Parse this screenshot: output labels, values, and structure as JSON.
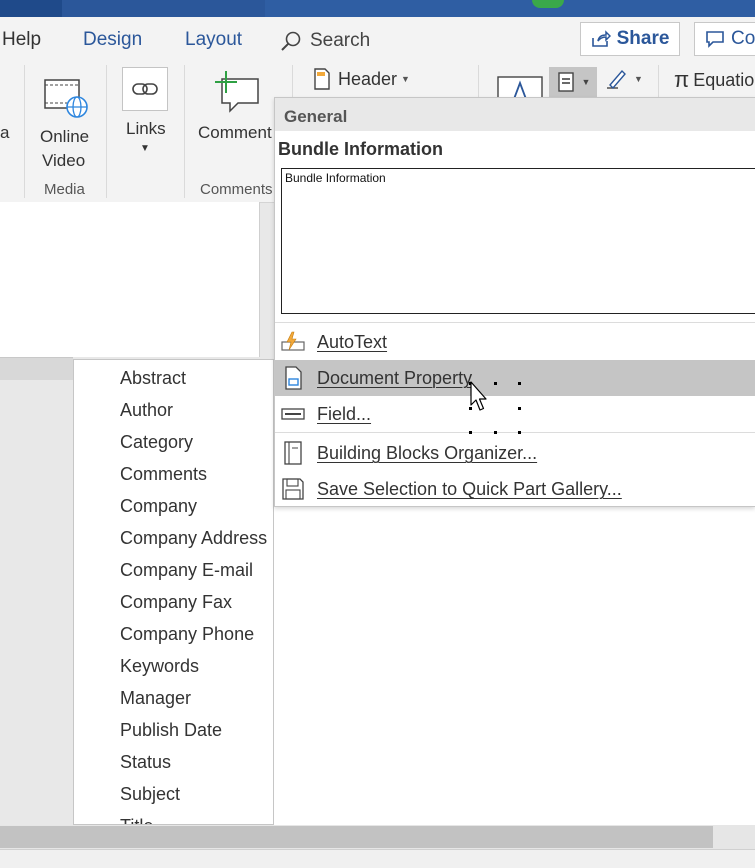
{
  "tabs": {
    "help": "Help",
    "design": "Design",
    "layout": "Layout",
    "search_placeholder": "Search"
  },
  "header_buttons": {
    "share": "Share",
    "comments": "Co"
  },
  "ribbon": {
    "partial_left": "a",
    "online_video_line1": "Online",
    "online_video_line2": "Video",
    "links": "Links",
    "comment": "Comment",
    "header": "Header",
    "equation": "Equatio",
    "groups": {
      "media": "Media",
      "comments": "Comments"
    }
  },
  "quick_parts_menu": {
    "general_header": "General",
    "bundle_title": "Bundle Information",
    "bundle_preview_text": "Bundle Information",
    "items": [
      {
        "label": "AutoText",
        "icon": "autotext-icon"
      },
      {
        "label": "Document Property",
        "icon": "document-property-icon",
        "highlighted": true
      },
      {
        "label": "Field...",
        "icon": "field-icon"
      },
      {
        "label": "Building Blocks Organizer...",
        "icon": "building-blocks-icon"
      },
      {
        "label": "Save Selection to Quick Part Gallery...",
        "icon": "save-selection-icon"
      }
    ]
  },
  "document_properties": [
    "Abstract",
    "Author",
    "Category",
    "Comments",
    "Company",
    "Company Address",
    "Company E-mail",
    "Company Fax",
    "Company Phone",
    "Keywords",
    "Manager",
    "Publish Date",
    "Status",
    "Subject",
    "Title"
  ],
  "colors": {
    "accent": "#2b579a",
    "menu_highlight": "#c5c5c5",
    "ribbon_bg": "#f3f3f3"
  }
}
